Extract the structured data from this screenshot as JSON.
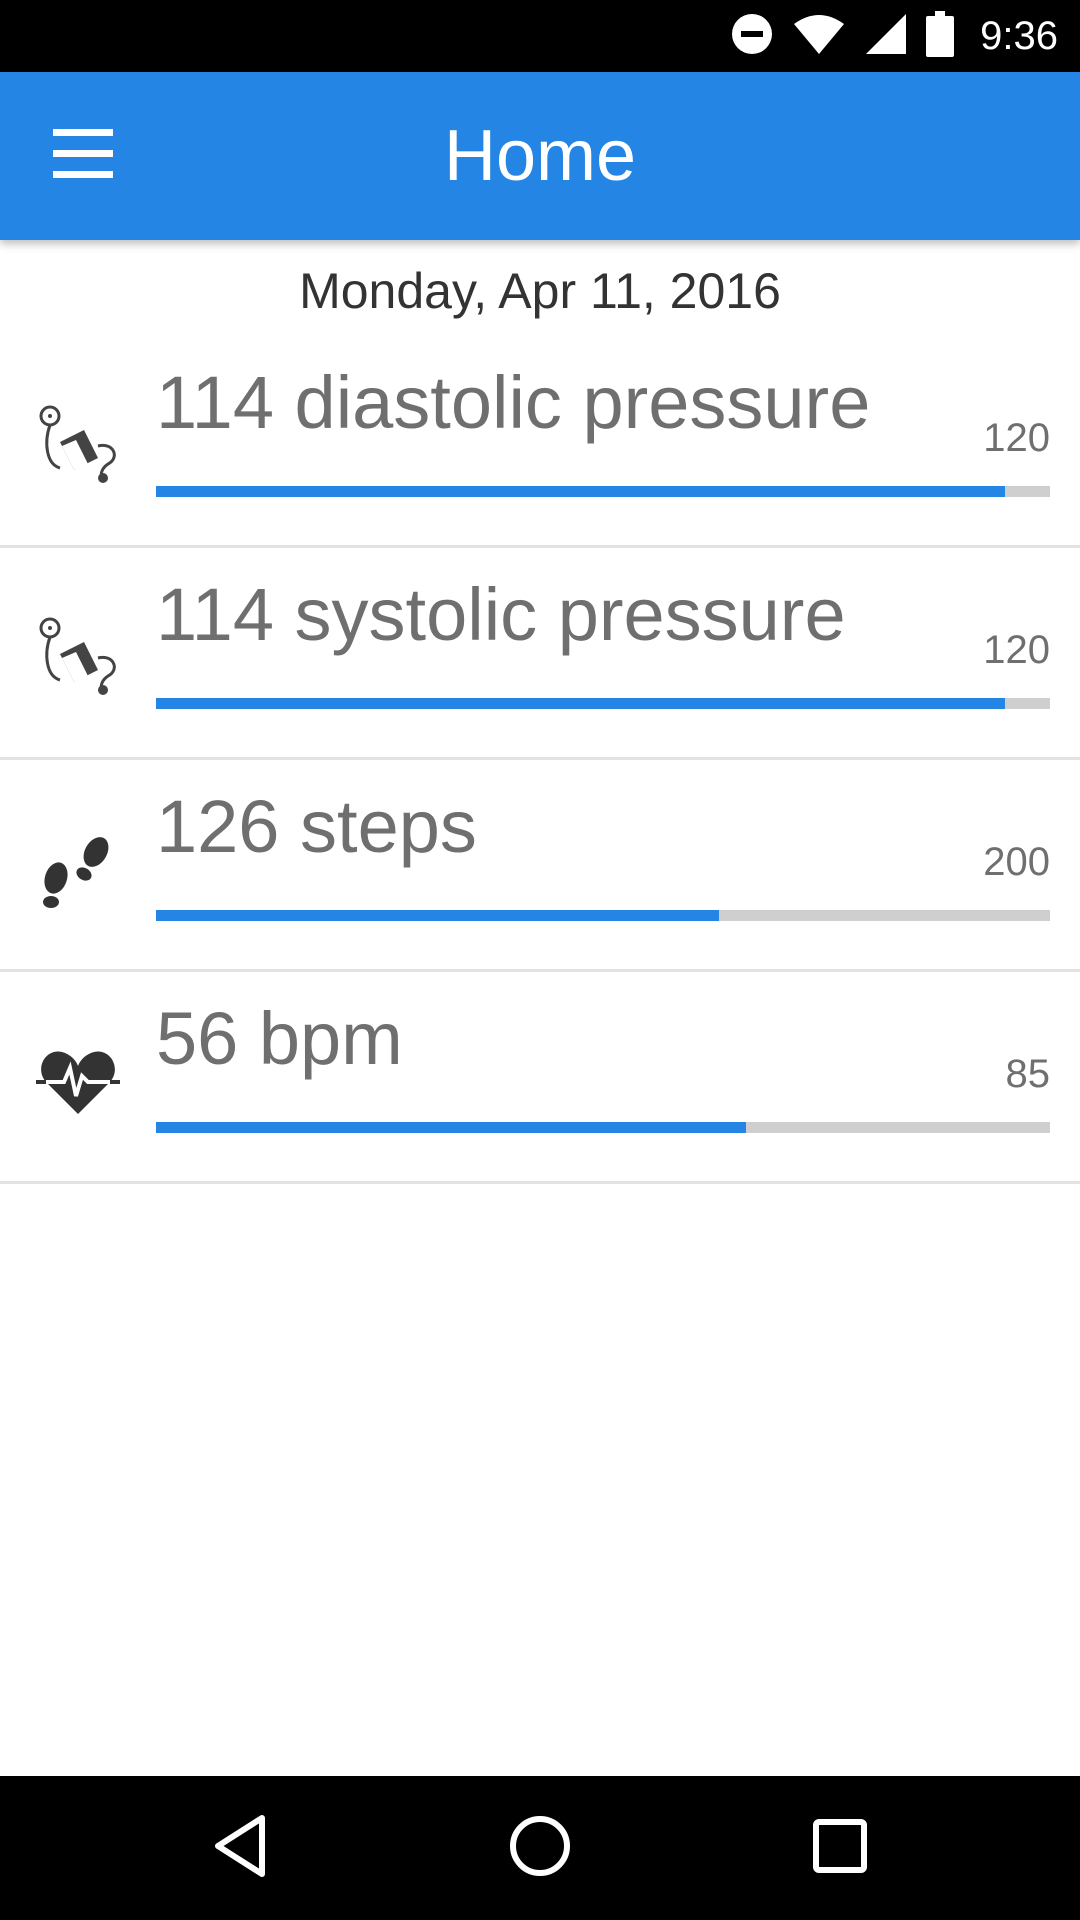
{
  "status_bar": {
    "time": "9:36",
    "icons": [
      "do-not-disturb-icon",
      "wifi-icon",
      "signal-icon",
      "battery-icon"
    ]
  },
  "app_bar": {
    "title": "Home",
    "menu_icon": "hamburger-menu-icon",
    "background_color": "#2485e5"
  },
  "date": "Monday, Apr 11, 2016",
  "metrics": [
    {
      "icon": "blood-pressure-icon",
      "label": "114 diastolic pressure",
      "goal": "120",
      "progress": 0.95
    },
    {
      "icon": "blood-pressure-icon",
      "label": "114 systolic pressure",
      "goal": "120",
      "progress": 0.95
    },
    {
      "icon": "footsteps-icon",
      "label": "126 steps",
      "goal": "200",
      "progress": 0.63
    },
    {
      "icon": "heart-rate-icon",
      "label": "56 bpm",
      "goal": "85",
      "progress": 0.66
    }
  ],
  "nav_bar": {
    "icons": [
      "back-icon",
      "home-icon",
      "recents-icon"
    ]
  },
  "colors": {
    "accent": "#2485e5",
    "track": "#cfcfcf",
    "text": "#6f6f6f"
  }
}
